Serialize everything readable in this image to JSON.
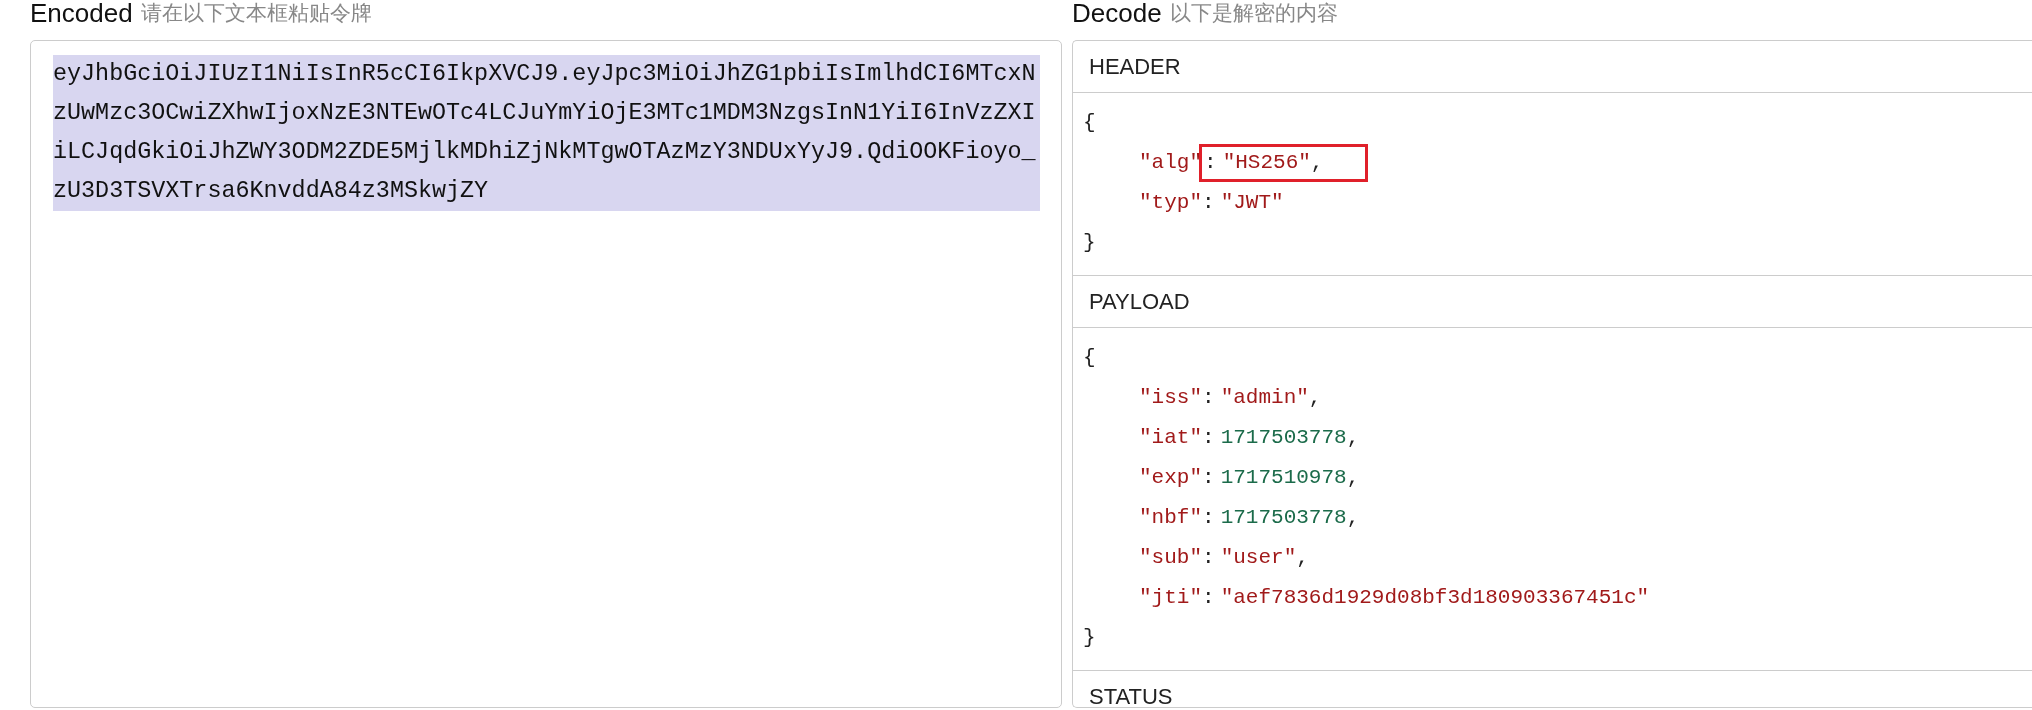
{
  "encoded": {
    "title": "Encoded",
    "subtitle": "请在以下文本框粘贴令牌",
    "token": "eyJhbGciOiJIUzI1NiIsInR5cCI6IkpXVCJ9.eyJpc3MiOiJhZG1pbiIsImlhdCI6MTcxNzUwMzc3OCwiZXhwIjoxNzE3NTEwOTc4LCJuYmYiOjE3MTc1MDM3NzgsInN1YiI6InVzZXIiLCJqdGkiOiJhZWY3ODM2ZDE5MjlkMDhiZjNkMTgwOTAzMzY3NDUxYyJ9.QdiOOKFioyo_zU3D3TSVXTrsa6KnvddA84z3MSkwjZY",
    "selected": true
  },
  "decode": {
    "title": "Decode",
    "subtitle": "以下是解密的内容",
    "sections": [
      {
        "title": "HEADER",
        "open": "{",
        "close": "}",
        "fields": [
          {
            "key": "\"alg\"",
            "colon": ":",
            "value": "\"HS256\"",
            "kind": "string",
            "comma": ",",
            "highlighted": true
          },
          {
            "key": "\"typ\"",
            "colon": ":",
            "value": "\"JWT\"",
            "kind": "string",
            "highlighted": false
          }
        ]
      },
      {
        "title": "PAYLOAD",
        "open": "{",
        "close": "}",
        "fields": [
          {
            "key": "\"iss\"",
            "colon": ":",
            "value": "\"admin\"",
            "kind": "string",
            "comma": ",",
            "highlighted": false
          },
          {
            "key": "\"iat\"",
            "colon": ":",
            "value": "1717503778",
            "kind": "number",
            "comma": ",",
            "highlighted": false
          },
          {
            "key": "\"exp\"",
            "colon": ":",
            "value": "1717510978",
            "kind": "number",
            "comma": ",",
            "highlighted": false
          },
          {
            "key": "\"nbf\"",
            "colon": ":",
            "value": "1717503778",
            "kind": "number",
            "comma": ",",
            "highlighted": false
          },
          {
            "key": "\"sub\"",
            "colon": ":",
            "value": "\"user\"",
            "kind": "string",
            "comma": ",",
            "highlighted": false
          },
          {
            "key": "\"jti\"",
            "colon": ":",
            "value": "\"aef7836d1929d08bf3d180903367451c\"",
            "kind": "string",
            "highlighted": false
          }
        ]
      },
      {
        "title": "STATUS"
      }
    ]
  }
}
